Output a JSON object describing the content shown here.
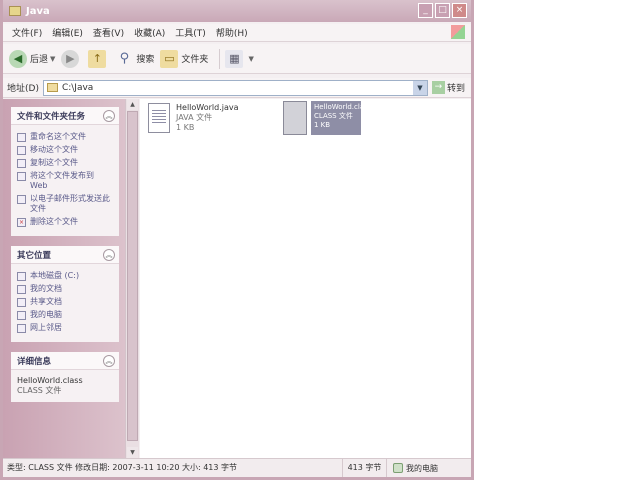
{
  "window": {
    "title": "Java"
  },
  "menu": [
    "文件(F)",
    "编辑(E)",
    "查看(V)",
    "收藏(A)",
    "工具(T)",
    "帮助(H)"
  ],
  "toolbar": {
    "back": "后退",
    "search": "搜索",
    "folders": "文件夹"
  },
  "address": {
    "label": "地址(D)",
    "value": "C:\\Java",
    "go": "转到"
  },
  "file_tasks": {
    "title": "文件和文件夹任务",
    "items": [
      {
        "icon": "rename-icon",
        "label": "重命名这个文件"
      },
      {
        "icon": "move-icon",
        "label": "移动这个文件"
      },
      {
        "icon": "copy-icon",
        "label": "复制这个文件"
      },
      {
        "icon": "publish-icon",
        "label": "将这个文件发布到 Web"
      },
      {
        "icon": "email-icon",
        "label": "以电子邮件形式发送此文件"
      },
      {
        "icon": "delete-icon",
        "label": "删除这个文件"
      }
    ]
  },
  "other_places": {
    "title": "其它位置",
    "items": [
      {
        "icon": "drive-icon",
        "label": "本地磁盘 (C:)"
      },
      {
        "icon": "documents-icon",
        "label": "我的文档"
      },
      {
        "icon": "shared-docs-icon",
        "label": "共享文档"
      },
      {
        "icon": "computer-icon",
        "label": "我的电脑"
      },
      {
        "icon": "network-icon",
        "label": "网上邻居"
      }
    ]
  },
  "details": {
    "title": "详细信息",
    "name": "HelloWorld.class",
    "type": "CLASS 文件"
  },
  "files": [
    {
      "name": "HelloWorld.java",
      "type": "JAVA 文件",
      "size": "1 KB"
    }
  ],
  "selected_file": {
    "name": "HelloWorld.class",
    "type": "CLASS 文件",
    "size": "1 KB"
  },
  "status": {
    "main": "类型: CLASS 文件 修改日期: 2007-3-11 10:20 大小: 413 字节",
    "size": "413 字节",
    "zone": "我的电脑"
  }
}
